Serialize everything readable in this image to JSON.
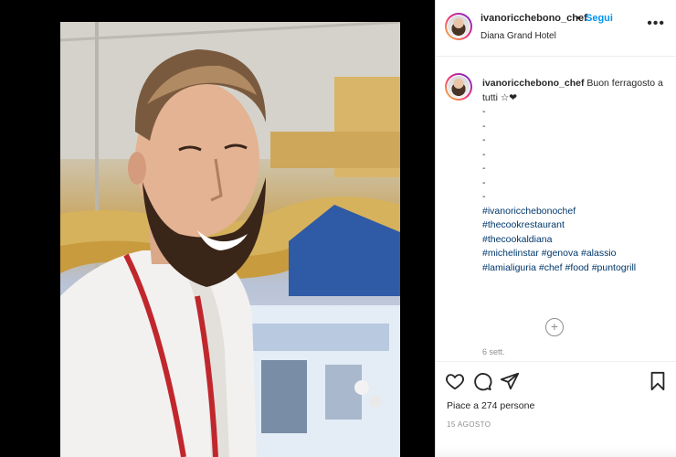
{
  "header": {
    "username": "ivanoricchebono_chef",
    "separator": "•",
    "follow_label": "Segui",
    "location": "Diana Grand Hotel",
    "more_label": "•••"
  },
  "caption": {
    "username": "ivanoricchebono_chef",
    "text": " Buon ferragosto a tutti ☆❤",
    "dashes": [
      "-",
      "-",
      "-",
      "-",
      "-",
      "-",
      "-"
    ],
    "hashtag_lines": [
      [
        "#ivanoricchebonochef"
      ],
      [
        "#thecookrestaurant"
      ],
      [
        "#thecookaldiana"
      ],
      [
        "#michelinstar",
        "#genova",
        "#alassio"
      ],
      [
        "#lamialiguria",
        "#chef",
        "#food",
        "#puntogrill"
      ]
    ],
    "time_ago": "6 sett.",
    "load_more_symbol": "+"
  },
  "actions": {
    "icons": [
      "heart-icon",
      "comment-icon",
      "share-icon",
      "bookmark-icon"
    ],
    "likes_text": "Piace a 274 persone",
    "date_text": "15 AGOSTO"
  },
  "colors": {
    "follow": "#0095f6",
    "hashtag": "#00376b",
    "text": "#262626",
    "muted": "#8e8e8e"
  }
}
